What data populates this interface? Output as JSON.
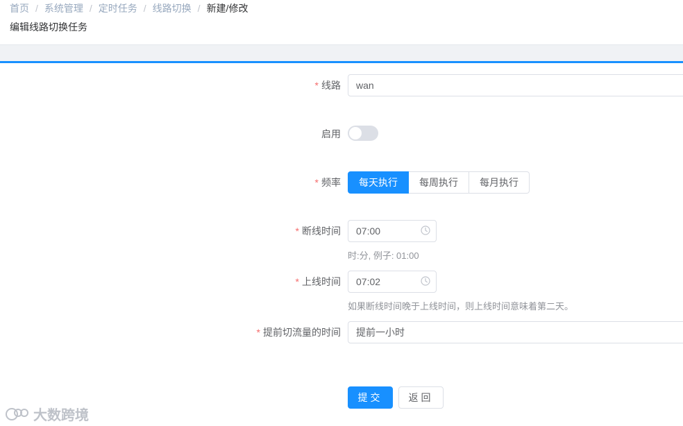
{
  "breadcrumb": {
    "items": [
      "首页",
      "系统管理",
      "定时任务",
      "线路切换"
    ],
    "current": "新建/修改",
    "separator": "/"
  },
  "page_title": "编辑线路切换任务",
  "form": {
    "line": {
      "label": "线路",
      "required": true,
      "value": "wan"
    },
    "enabled": {
      "label": "启用",
      "checked": false
    },
    "frequency": {
      "label": "频率",
      "required": true,
      "options": [
        "每天执行",
        "每周执行",
        "每月执行"
      ],
      "selected": "每天执行"
    },
    "disconnect_time": {
      "label": "断线时间",
      "required": true,
      "value": "07:00",
      "hint": "时:分, 例子: 01:00"
    },
    "online_time": {
      "label": "上线时间",
      "required": true,
      "value": "07:02",
      "hint": "如果断线时间晚于上线时间，则上线时间意味着第二天。"
    },
    "advance_switch": {
      "label": "提前切流量的时间",
      "required": true,
      "value": "提前一小时"
    }
  },
  "buttons": {
    "submit": "提交",
    "back": "返回"
  },
  "watermark": {
    "text": "大数跨境"
  },
  "colors": {
    "primary": "#1890ff",
    "required": "#f56c6c",
    "border": "#dcdfe6"
  },
  "icons": {
    "clock": "clock-icon",
    "logo": "watermark-logo-icon"
  }
}
